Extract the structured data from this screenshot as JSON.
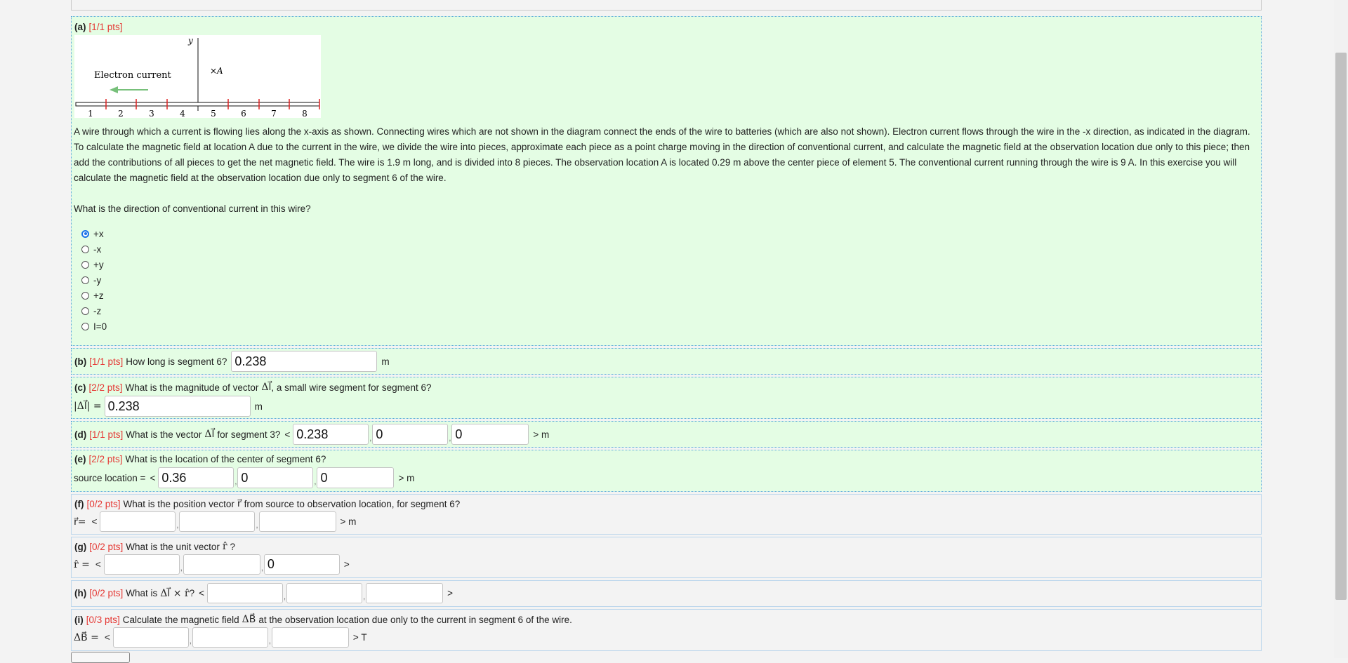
{
  "diagram": {
    "y_axis_label": "y",
    "electron_label": "Electron current",
    "point_label": "×A",
    "tick_labels": [
      "1",
      "2",
      "3",
      "4",
      "5",
      "6",
      "7",
      "8"
    ]
  },
  "a": {
    "label": "(a)",
    "pts": "[1/1 pts]",
    "description": "A wire through which a current is flowing lies along the x-axis as shown. Connecting wires which are not shown in the diagram connect the ends of the wire to batteries (which are also not shown). Electron current flows through the wire in the -x direction, as indicated in the diagram. To calculate the magnetic field at location A due to the current in the wire, we divide the wire into pieces, approximate each piece as a point charge moving in the direction of conventional current, and calculate the magnetic field at the observation location due only to this piece; then add the contributions of all pieces to get the net magnetic field. The wire is 1.9 m long, and is divided into 8 pieces. The observation location A is located 0.29 m above the center piece of element 5. The conventional current running through the wire is 9 A. In this exercise you will calculate the magnetic field at the observation location due only to segment 6 of the wire.",
    "question": "What is the direction of conventional current in this wire?",
    "options": [
      "+x",
      "-x",
      "+y",
      "-y",
      "+z",
      "-z",
      "I=0"
    ],
    "selected": "+x"
  },
  "b": {
    "label": "(b)",
    "pts": "[1/1 pts]",
    "question": "How long is segment 6?",
    "value": "0.238",
    "unit": "m"
  },
  "c": {
    "label": "(c)",
    "pts": "[2/2 pts]",
    "q1": "What is the magnitude of vector",
    "vec": "Δl⃗",
    "q2": ", a small wire segment for segment 6?",
    "prefix": "|Δl⃗| =",
    "value": "0.238",
    "unit": "m"
  },
  "d": {
    "label": "(d)",
    "pts": "[1/1 pts]",
    "q1": "What is the vector",
    "vec": "Δl⃗",
    "q2": "for segment 3?",
    "open": "<",
    "values": [
      "0.238",
      "0",
      "0"
    ],
    "close": "> m"
  },
  "e": {
    "label": "(e)",
    "pts": "[2/2 pts]",
    "question": "What is the location of the center of segment 6?",
    "prefix": "source location =",
    "open": "<",
    "values": [
      "0.36",
      "0",
      "0"
    ],
    "close": "> m"
  },
  "f": {
    "label": "(f)",
    "pts": "[0/2 pts]",
    "q1": "What is the position vector",
    "vec": "r⃗",
    "q2": "from source to observation location, for segment 6?",
    "prefix": "r⃗=",
    "open": "<",
    "values": [
      "",
      "",
      ""
    ],
    "close": "> m"
  },
  "g": {
    "label": "(g)",
    "pts": "[0/2 pts]",
    "q1": "What is the unit vector",
    "vec": "r̂",
    "q2": "?",
    "prefix": "r̂ =",
    "open": "<",
    "values": [
      "",
      "",
      "0"
    ],
    "close": ">"
  },
  "h": {
    "label": "(h)",
    "pts": "[0/2 pts]",
    "q1": "What is",
    "vec": "Δl⃗ × r̂",
    "q2": "?",
    "open": "<",
    "values": [
      "",
      "",
      ""
    ],
    "close": ">"
  },
  "i": {
    "label": "(i)",
    "pts": "[0/3 pts]",
    "q1": "Calculate the magnetic field",
    "vec": "ΔB⃗",
    "q2": "at the observation location due only to the current in segment 6 of the wire.",
    "prefix": "ΔB⃗ =",
    "open": "<",
    "values": [
      "",
      "",
      ""
    ],
    "close": "> T"
  }
}
